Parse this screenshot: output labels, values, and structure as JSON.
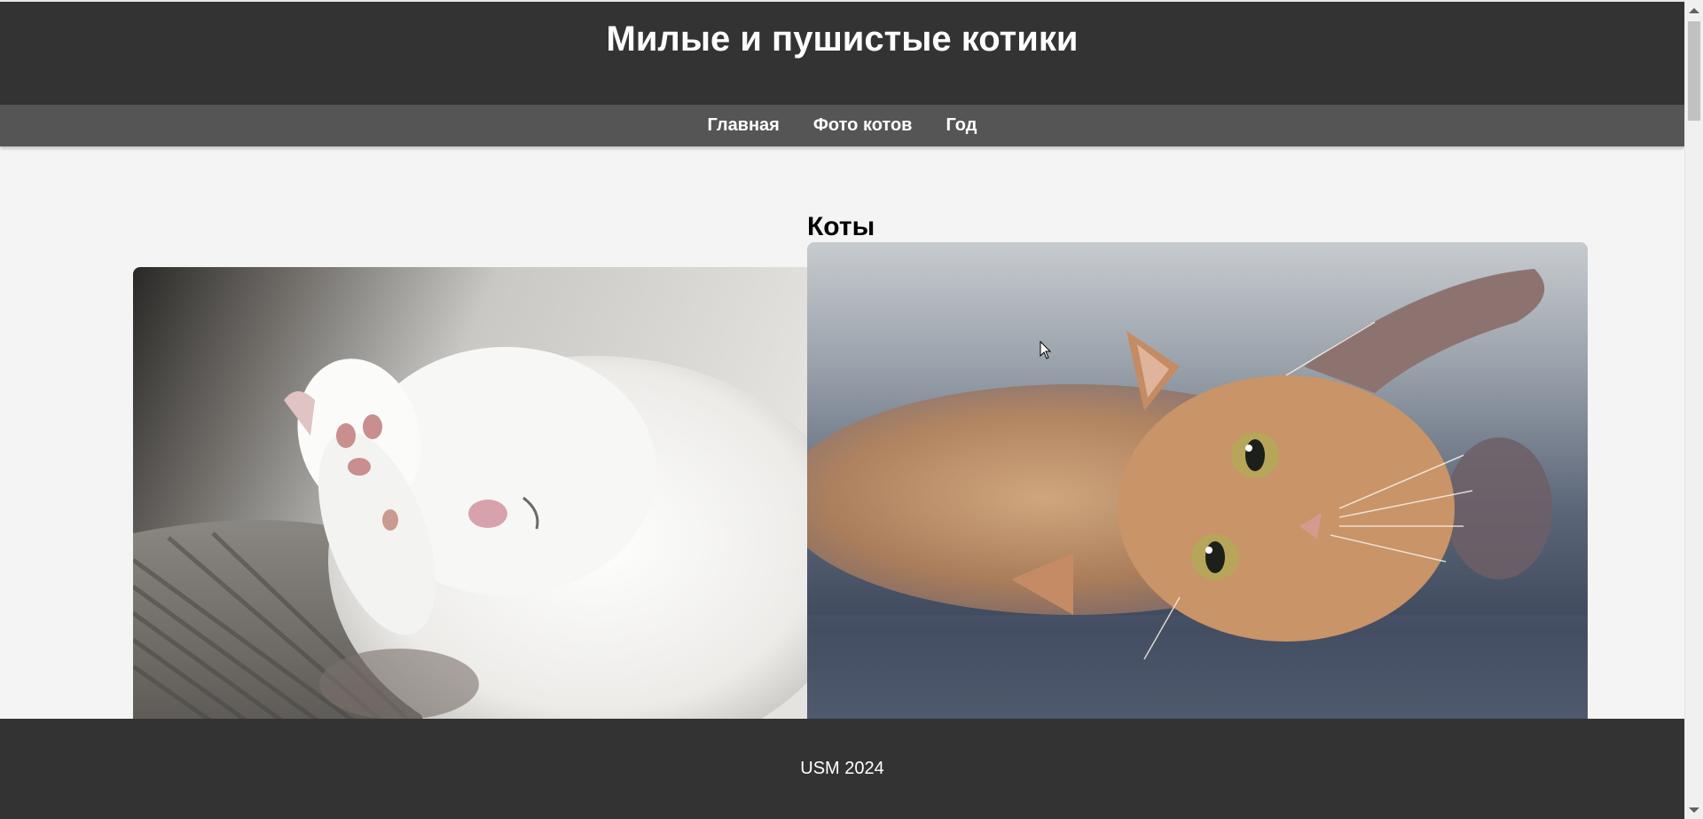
{
  "header": {
    "title": "Милые и пушистые котики"
  },
  "nav": {
    "items": [
      {
        "label": "Главная"
      },
      {
        "label": "Фото котов"
      },
      {
        "label": "Год"
      }
    ]
  },
  "main": {
    "section_title": "Коты",
    "photos": [
      {
        "icon": "white-sleeping-kitten-photo"
      },
      {
        "icon": "ginger-cat-lying-photo"
      }
    ]
  },
  "footer": {
    "text": "USM 2024"
  },
  "colors": {
    "header_bg": "#333333",
    "nav_bg": "#555555",
    "page_bg": "#f4f4f4",
    "footer_bg": "#333333"
  }
}
